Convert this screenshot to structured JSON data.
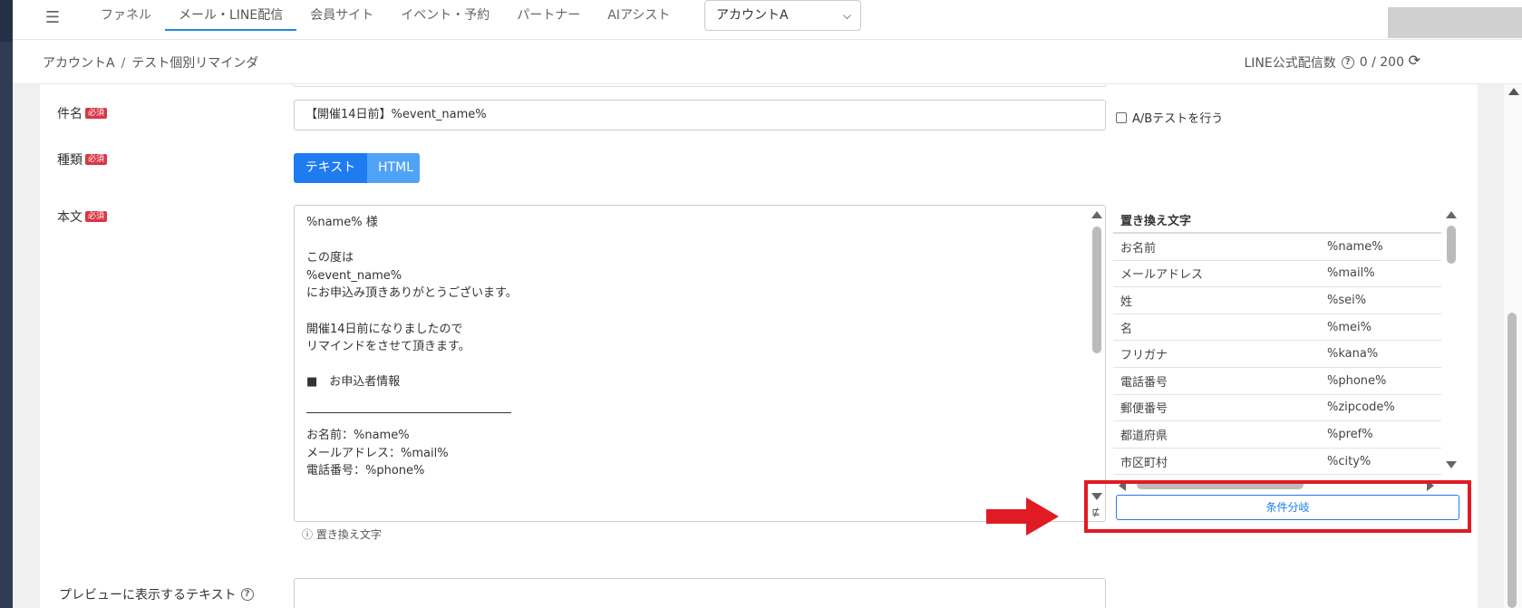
{
  "nav": {
    "tabs": [
      {
        "label": "ファネル"
      },
      {
        "label": "メール・LINE配信"
      },
      {
        "label": "会員サイト"
      },
      {
        "label": "イベント・予約"
      },
      {
        "label": "パートナー"
      },
      {
        "label": "AIアシスト"
      }
    ],
    "active_tab": "メール・LINE配信",
    "account_select": "アカウントA"
  },
  "breadcrumb": {
    "items": [
      "アカウントA",
      "テスト個別リマインダ"
    ],
    "separator": "/"
  },
  "line_count": {
    "label": "LINE公式配信数",
    "value": "0 / 200"
  },
  "form": {
    "subject_label": "件名",
    "required_badge": "必須",
    "subject_value": "【開催14日前】%event_name%",
    "ab_test_label": "A/Bテストを行う",
    "type_label": "種類",
    "type_options": [
      "テキスト",
      "HTML"
    ],
    "type_selected": "テキスト",
    "body_label": "本文",
    "body_lines": [
      "%name% 様",
      "",
      "この度は",
      "%event_name%",
      "にお申込み頂きありがとうございます。",
      "",
      "開催14日前になりましたので",
      "リマインドをさせて頂きます。",
      "",
      "■　お申込者情報",
      "",
      "",
      "お名前：%name%",
      "メールアドレス：%mail%",
      "電話番号：%phone%"
    ],
    "replacement_hint": "置き換え文字",
    "preview_label": "プレビューに表示するテキスト"
  },
  "replacement_table": {
    "header": "置き換え文字",
    "rows": [
      {
        "key": "お名前",
        "value": "%name%"
      },
      {
        "key": "メールアドレス",
        "value": "%mail%"
      },
      {
        "key": "姓",
        "value": "%sei%"
      },
      {
        "key": "名",
        "value": "%mei%"
      },
      {
        "key": "フリガナ",
        "value": "%kana%"
      },
      {
        "key": "電話番号",
        "value": "%phone%"
      },
      {
        "key": "郵便番号",
        "value": "%zipcode%"
      },
      {
        "key": "都道府県",
        "value": "%pref%"
      },
      {
        "key": "市区町村",
        "value": "%city%"
      }
    ]
  },
  "condition_button": "条件分岐",
  "colors": {
    "primary": "#1f7cf0",
    "required": "#dc3545",
    "highlight": "#e01b24",
    "sidebar": "#2f3c55"
  }
}
